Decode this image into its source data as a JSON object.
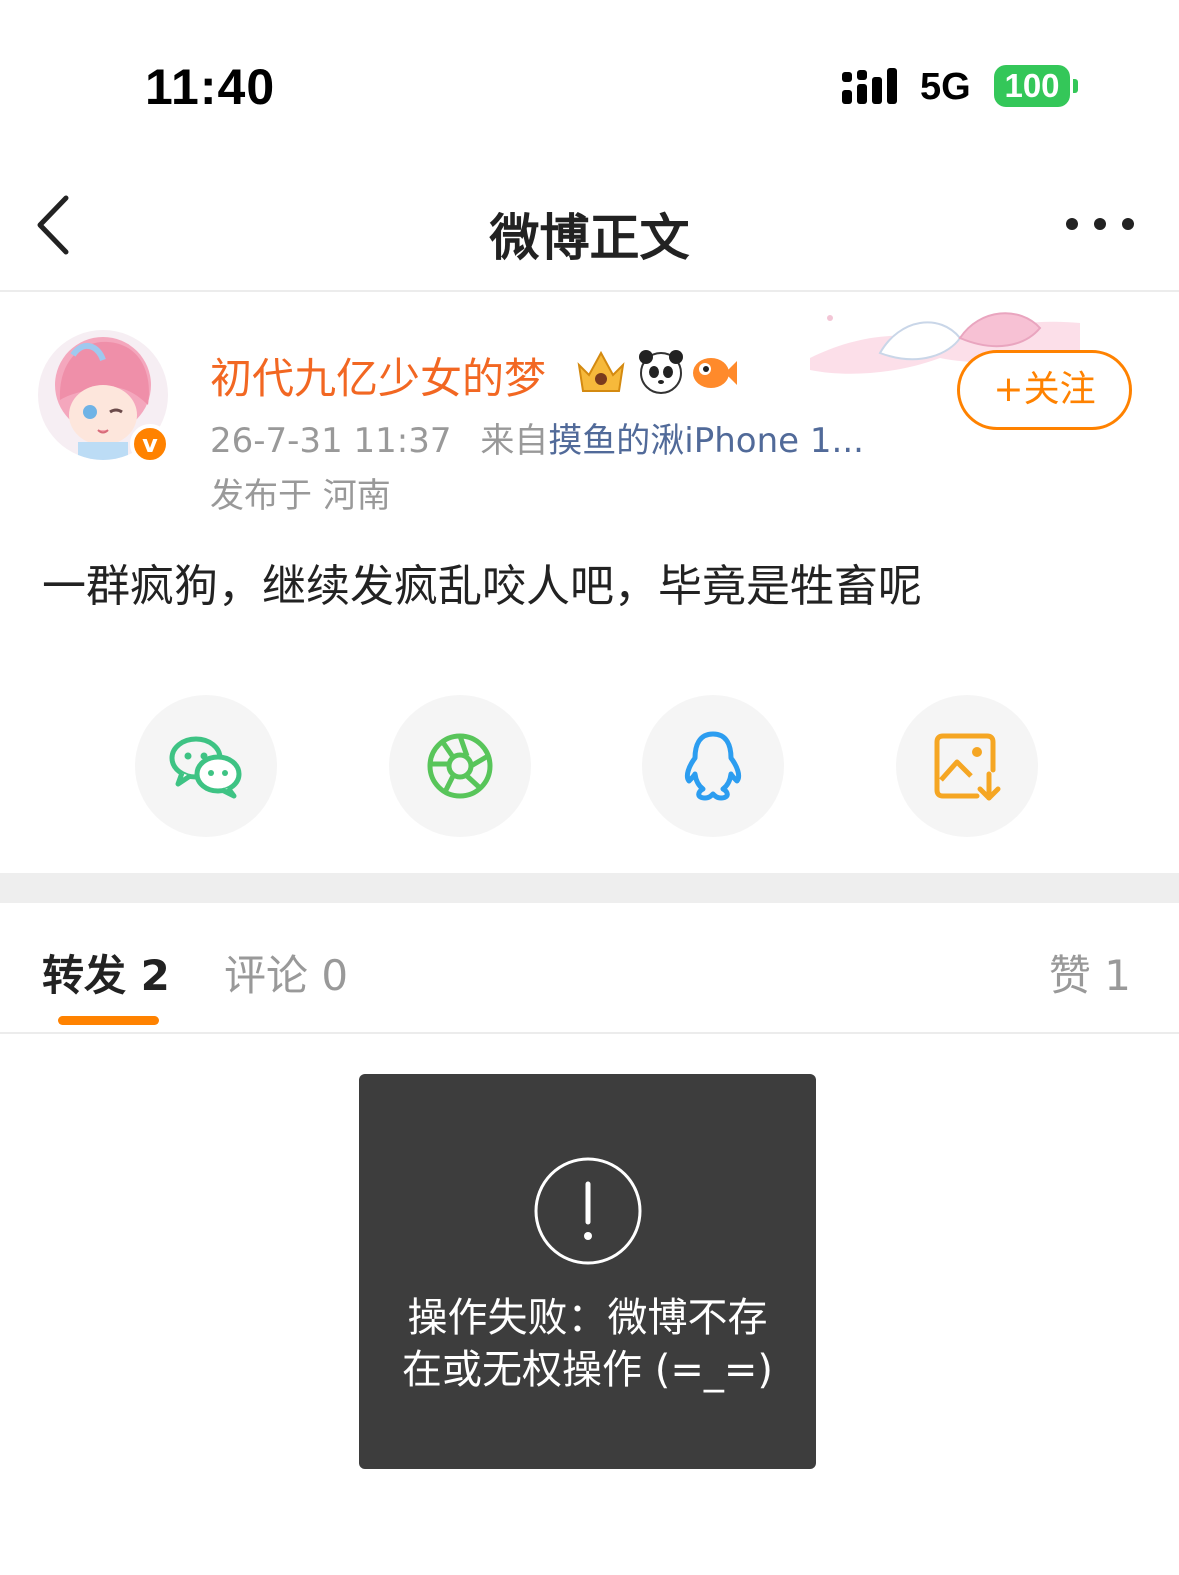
{
  "status_bar": {
    "time": "11:40",
    "network": "5G",
    "battery": "100"
  },
  "nav": {
    "title": "微博正文",
    "back_icon": "chevron-left-icon",
    "more_icon": "more-dots-icon"
  },
  "post": {
    "username": "初代九亿少女的梦",
    "badges": [
      "crown-badge-icon",
      "panda-badge-icon",
      "fish-badge-icon"
    ],
    "time": "26-7-31 11:37",
    "source_prefix": "来自",
    "source": "摸鱼的湫iPhone 1...",
    "location": "发布于 河南",
    "follow_label": "+关注",
    "content": "一群疯狗，继续发疯乱咬人吧，毕竟是牲畜呢"
  },
  "share": [
    {
      "name": "wechat",
      "icon": "wechat-icon",
      "color": "#3ec384"
    },
    {
      "name": "moments",
      "icon": "moments-icon",
      "color": "#58c55a"
    },
    {
      "name": "qq",
      "icon": "qq-icon",
      "color": "#2c9df0"
    },
    {
      "name": "save-image",
      "icon": "save-image-icon",
      "color": "#f5a623"
    }
  ],
  "tabs": {
    "repost": "转发 2",
    "comment": "评论 0",
    "like": "赞 1"
  },
  "toast": {
    "message": "操作失败：微博不存在或无权操作 (=_=)"
  },
  "colors": {
    "accent": "#ff8200",
    "username": "#f26722",
    "source_link": "#516a99",
    "battery": "#34c759"
  }
}
